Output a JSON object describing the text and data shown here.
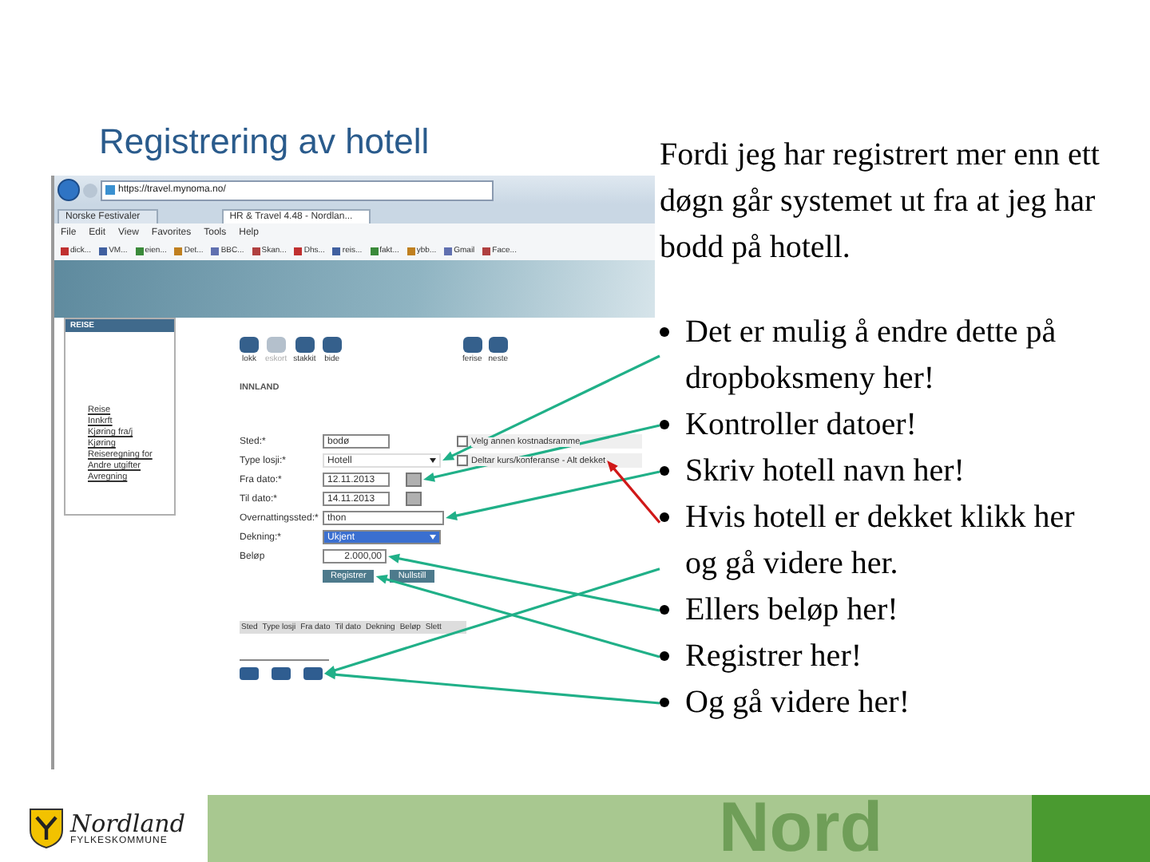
{
  "slide_title": "Registrering av hotell",
  "intro": "Fordi jeg har registrert mer enn ett døgn går systemet ut fra at jeg har bodd på hotell.",
  "bullets": [
    "Det er mulig å endre dette på dropboksmeny her!",
    "Kontroller datoer!",
    "Skriv hotell navn her!",
    "Hvis hotell er dekket klikk her og gå videre her.",
    "Ellers beløp her!",
    "Registrer her!",
    "Og gå videre her!"
  ],
  "screenshot": {
    "browser": {
      "url": "https://travel.mynoma.no/",
      "tabs": [
        {
          "label": "Norske Festivaler",
          "selected": false
        },
        {
          "label": "HR & Travel 4.48 - Nordlan...",
          "selected": true
        }
      ],
      "menu": [
        "File",
        "Edit",
        "View",
        "Favorites",
        "Tools",
        "Help"
      ],
      "favorites": [
        "dick...",
        "VM...",
        "eien...",
        "Det...",
        "BBC...",
        "Skan...",
        "Dhs...",
        "reis...",
        "fakt...",
        "ybb...",
        "Gmail",
        "Face..."
      ]
    },
    "sidebar": {
      "heading": "REISE",
      "links": [
        "Reise",
        "Innkrft",
        "Kjøring fra/j",
        "Kjøring",
        "Reiseregning for",
        "Andre utgifter",
        "Avregning"
      ]
    },
    "toolbar": [
      {
        "label": "lokk",
        "disabled": false
      },
      {
        "label": "eskort",
        "disabled": true
      },
      {
        "label": "stakkit",
        "disabled": false
      },
      {
        "label": "bide",
        "disabled": false
      },
      {
        "label": "ferise",
        "disabled": false
      },
      {
        "label": "neste",
        "disabled": false
      }
    ],
    "section": "INNLAND",
    "fields": [
      {
        "label": "Sted:*",
        "kind": "text",
        "value": "bodø",
        "highlighted": false
      },
      {
        "label": "Type losji:*",
        "kind": "select",
        "value": "Hotell",
        "highlighted": false
      },
      {
        "label": "Fra dato:*",
        "kind": "date",
        "value": "12.11.2013",
        "highlighted": false
      },
      {
        "label": "Til dato:*",
        "kind": "date",
        "value": "14.11.2013",
        "highlighted": false
      },
      {
        "label": "Overnattingssted:*",
        "kind": "wide",
        "value": "thon",
        "highlighted": false
      },
      {
        "label": "Dekning:*",
        "kind": "select",
        "value": "Ukjent",
        "highlighted": true
      },
      {
        "label": "Beløp",
        "kind": "amount",
        "value": "2.000,00",
        "highlighted": false
      }
    ],
    "options": [
      {
        "label": "Velg annen kostnadsramme",
        "checked": false
      },
      {
        "label": "Deltar kurs/konferanse - Alt dekket",
        "checked": false
      }
    ],
    "buttons": [
      "Registrer",
      "Nullstill"
    ],
    "table_columns": [
      "Sted",
      "Type losji",
      "Fra dato",
      "Til dato",
      "Dekning",
      "Beløp",
      "Slett"
    ]
  },
  "arrows": [
    {
      "color": "#20b088"
    },
    {
      "color": "#20b088"
    },
    {
      "color": "#20b088"
    },
    {
      "color": "#d01818"
    },
    {
      "color": "#20b088"
    },
    {
      "color": "#20b088"
    },
    {
      "color": "#20b088"
    },
    {
      "color": "#20b088"
    }
  ],
  "footer": {
    "logo_name": "Nordland",
    "logo_sub": "FYLKESKOMMUNE",
    "backdrop_text": "Nord"
  }
}
